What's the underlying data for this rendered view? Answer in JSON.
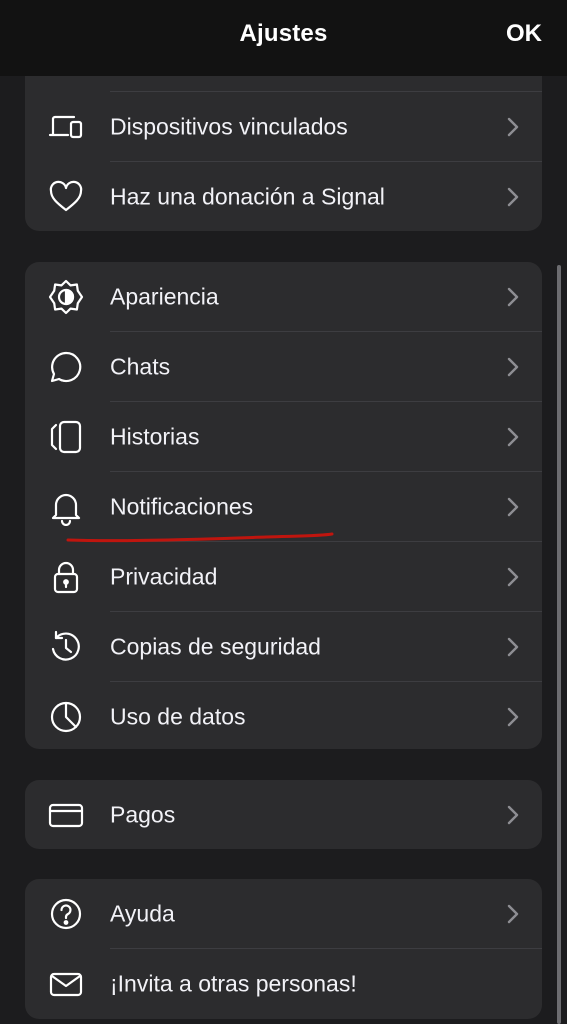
{
  "header": {
    "title": "Ajustes",
    "done_label": "OK"
  },
  "groups": [
    {
      "items": [
        {
          "label": "",
          "icon": "partial-row"
        },
        {
          "label": "Dispositivos vinculados",
          "icon": "linked-devices-icon"
        },
        {
          "label": "Haz una donación a Signal",
          "icon": "heart-icon"
        }
      ]
    },
    {
      "items": [
        {
          "label": "Apariencia",
          "icon": "appearance-icon"
        },
        {
          "label": "Chats",
          "icon": "chat-bubble-icon"
        },
        {
          "label": "Historias",
          "icon": "stories-icon"
        },
        {
          "label": "Notificaciones",
          "icon": "bell-icon"
        },
        {
          "label": "Privacidad",
          "icon": "lock-icon"
        },
        {
          "label": "Copias de seguridad",
          "icon": "backup-clock-icon"
        },
        {
          "label": "Uso de datos",
          "icon": "pie-chart-icon"
        }
      ]
    },
    {
      "items": [
        {
          "label": "Pagos",
          "icon": "card-icon"
        }
      ]
    },
    {
      "items": [
        {
          "label": "Ayuda",
          "icon": "help-icon"
        },
        {
          "label": "¡Invita a otras personas!",
          "icon": "mail-icon"
        }
      ]
    }
  ],
  "colors": {
    "background": "#1c1c1e",
    "nav_background": "#121212",
    "group_background": "#2c2c2e",
    "separator": "#3d3d41",
    "chevron": "#8e8e93",
    "annotation": "#c0150e"
  }
}
